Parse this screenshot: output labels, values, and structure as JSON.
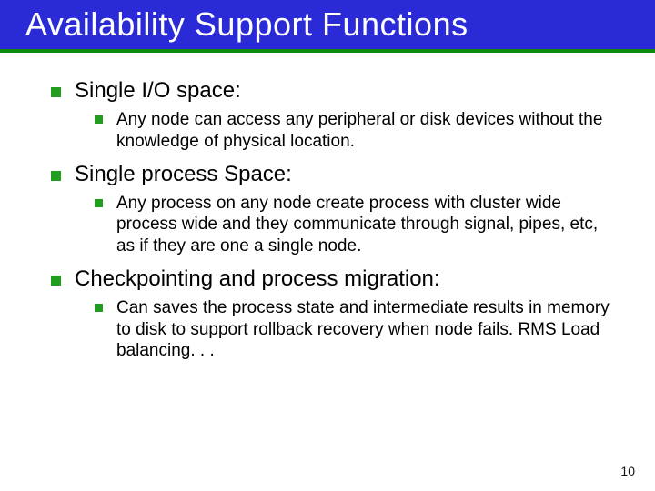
{
  "title": "Availability Support Functions",
  "items": [
    {
      "heading": "Single I/O space:",
      "sub": [
        "Any node can access any peripheral or disk devices without the knowledge of physical location."
      ]
    },
    {
      "heading": "Single process Space:",
      "sub": [
        " Any process on any node create process with cluster wide process wide and they communicate through signal, pipes, etc, as if they are one a single node."
      ]
    },
    {
      "heading": "Checkpointing and process migration:",
      "sub": [
        "Can saves the process state and intermediate results in memory to disk to support rollback recovery when node fails. RMS Load balancing. . ."
      ]
    }
  ],
  "page_number": "10"
}
